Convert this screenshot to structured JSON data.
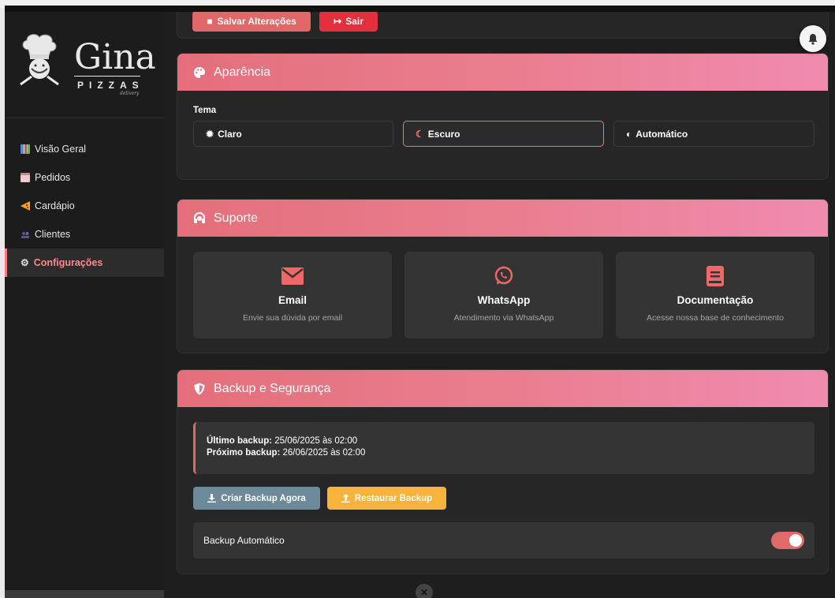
{
  "brand": {
    "name": "Gina",
    "sub": "PIZZAS",
    "tagline": "delivery"
  },
  "sidebar": {
    "items": [
      {
        "label": "Visão Geral",
        "icon": "chart-icon",
        "active": false
      },
      {
        "label": "Pedidos",
        "icon": "clipboard-icon",
        "active": false
      },
      {
        "label": "Cardápio",
        "icon": "pizza-icon",
        "active": false
      },
      {
        "label": "Clientes",
        "icon": "users-icon",
        "active": false
      },
      {
        "label": "Configurações",
        "icon": "gear-icon",
        "active": true
      }
    ]
  },
  "top_actions": {
    "save_label": "Salvar Alterações",
    "exit_label": "Sair"
  },
  "appearance": {
    "title": "Aparência",
    "theme_label": "Tema",
    "options": [
      {
        "label": "Claro",
        "icon": "sun-icon",
        "selected": false
      },
      {
        "label": "Escuro",
        "icon": "moon-icon",
        "selected": true
      },
      {
        "label": "Automático",
        "icon": "half-circle-icon",
        "selected": false
      }
    ]
  },
  "support": {
    "title": "Suporte",
    "tiles": [
      {
        "title": "Email",
        "desc": "Envie sua dúvida por email",
        "icon": "envelope-icon"
      },
      {
        "title": "WhatsApp",
        "desc": "Atendimento via WhatsApp",
        "icon": "whatsapp-icon"
      },
      {
        "title": "Documentação",
        "desc": "Acesse nossa base de conhecimento",
        "icon": "book-icon"
      }
    ]
  },
  "backup": {
    "title": "Backup e Segurança",
    "last_label": "Último backup:",
    "last_value": "25/06/2025 às 02:00",
    "next_label": "Próximo backup:",
    "next_value": "26/06/2025 às 02:00",
    "create_label": "Criar Backup Agora",
    "restore_label": "Restaurar Backup",
    "auto_label": "Backup Automático",
    "auto_enabled": true
  },
  "colors": {
    "accent": "#e26767",
    "header_gradient_start": "#e46f7a",
    "header_gradient_end": "#f08bb0",
    "restore": "#f8b33a",
    "create": "#6d8a9a"
  }
}
